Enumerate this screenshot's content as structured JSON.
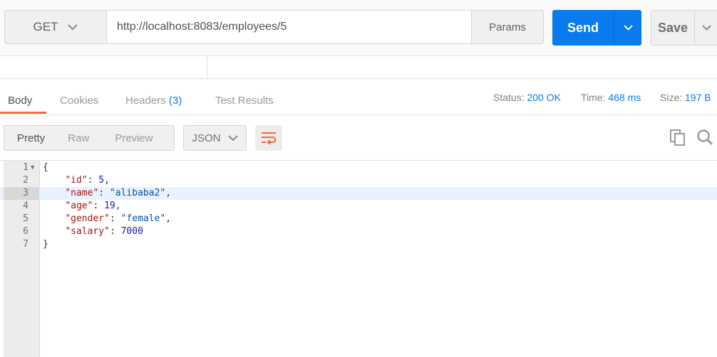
{
  "request": {
    "method": "GET",
    "url": "http://localhost:8083/employees/5",
    "params_label": "Params",
    "send_label": "Send",
    "save_label": "Save"
  },
  "response_tabs": [
    {
      "label": "Body",
      "active": true
    },
    {
      "label": "Cookies"
    },
    {
      "label": "Headers",
      "count": "(3)"
    },
    {
      "label": "Test Results"
    }
  ],
  "status": {
    "label": "Status:",
    "value": "200 OK"
  },
  "time": {
    "label": "Time:",
    "value": "468 ms"
  },
  "size": {
    "label": "Size:",
    "value": "197 B"
  },
  "view_modes": [
    "Pretty",
    "Raw",
    "Preview"
  ],
  "format": "JSON",
  "code_lines": [
    {
      "num": "1",
      "text": "{"
    },
    {
      "num": "2",
      "key": "\"id\"",
      "value": "5",
      "value_type": "number",
      "comma": ","
    },
    {
      "num": "3",
      "key": "\"name\"",
      "value": "\"alibaba2\"",
      "value_type": "string",
      "comma": ","
    },
    {
      "num": "4",
      "key": "\"age\"",
      "value": "19",
      "value_type": "number",
      "comma": ","
    },
    {
      "num": "5",
      "key": "\"gender\"",
      "value": "\"female\"",
      "value_type": "string",
      "comma": ","
    },
    {
      "num": "6",
      "key": "\"salary\"",
      "value": "7000",
      "value_type": "number",
      "comma": ""
    },
    {
      "num": "7",
      "text": "}"
    }
  ],
  "colors": {
    "accent": "#097bed",
    "tab_underline": "#f26b3a",
    "json_key": "#a31515",
    "json_string": "#0451a5"
  }
}
